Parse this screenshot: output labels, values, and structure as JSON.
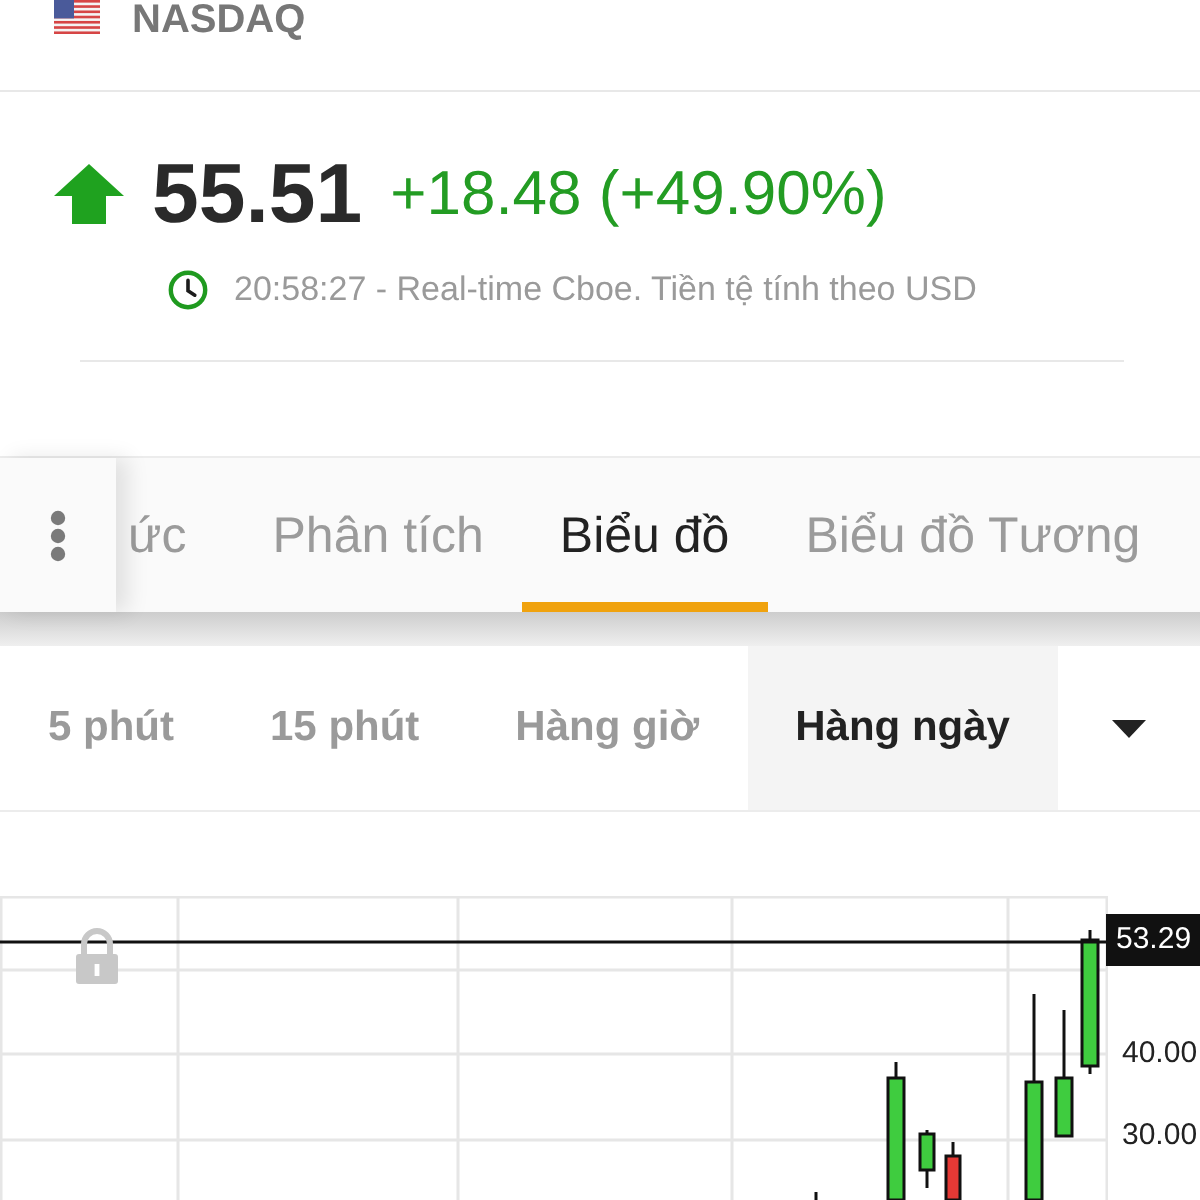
{
  "header": {
    "exchange": "NASDAQ"
  },
  "quote": {
    "rising": true,
    "price": "55.51",
    "change": "+18.48 (+49.90%)",
    "timestamp": "20:58:27 - Real-time Cboe. Tiền tệ tính theo USD"
  },
  "tabs": [
    {
      "label": "ức",
      "selected": false
    },
    {
      "label": "Phân tích",
      "selected": false
    },
    {
      "label": "Biểu đồ",
      "selected": true
    },
    {
      "label": "Biểu đồ Tương",
      "selected": false
    }
  ],
  "intervals": [
    {
      "label": "5 phút",
      "selected": false
    },
    {
      "label": "15 phút",
      "selected": false
    },
    {
      "label": "Hàng giờ",
      "selected": false
    },
    {
      "label": "Hàng ngày",
      "selected": true
    }
  ],
  "chart": {
    "last_price": "53.29",
    "y_labels": [
      "40.00",
      "30.00"
    ],
    "candles": [
      {
        "kind": "up"
      },
      {
        "kind": "up"
      },
      {
        "kind": "down"
      },
      {
        "kind": "up"
      },
      {
        "kind": "up"
      },
      {
        "kind": "up"
      }
    ]
  }
}
